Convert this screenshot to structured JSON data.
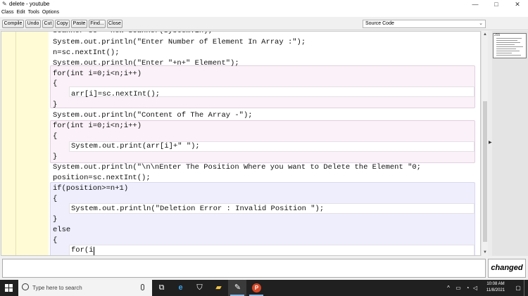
{
  "window": {
    "title": "delete - youtube",
    "app_icon": "bluej-bird-icon",
    "controls": {
      "minimize": "—",
      "maximize": "□",
      "close": "✕"
    }
  },
  "menubar": {
    "items": [
      "Class",
      "Edit",
      "Tools",
      "Options"
    ]
  },
  "toolbar": {
    "buttons": [
      "Compile",
      "Undo",
      "Cut",
      "Copy",
      "Paste",
      "Find...",
      "Close"
    ],
    "view_select": "Source Code"
  },
  "editor": {
    "lines": [
      "Scanner sc = new Scanner(System.in);",
      "System.out.println(\"Enter Number of Element In Array :\");",
      "n=sc.nextInt();",
      "System.out.println(\"Enter \"+n+\" Element\");",
      "for(int i=0;i<n;i++)",
      "{",
      "arr[i]=sc.nextInt();",
      "}",
      "System.out.println(\"Content of The Array -\");",
      "for(int i=0;i<n;i++)",
      "{",
      "System.out.print(arr[i]+\" \");",
      "}",
      "System.out.println(\"\\n\\nEnter The Position Where you want to Delete the Element \"0;",
      "position=sc.nextInt();",
      "if(position>=n+1)",
      "{",
      "System.out.println(\"Deletion Error : Invalid Position \");",
      "}",
      "else",
      "{",
      "for(i"
    ],
    "overview_label": "255"
  },
  "status": {
    "message": "",
    "changed_label": "changed"
  },
  "taskbar": {
    "search_placeholder": "Type here to search",
    "time": "10:08 AM",
    "date": "11/8/2021",
    "icons": [
      "task-view-icon",
      "edge-icon",
      "store-icon",
      "file-explorer-icon",
      "bluej-icon",
      "powerpoint-icon"
    ]
  },
  "colors": {
    "gutter": "#fffbd5",
    "scope_method": "#fbf1f8",
    "scope_conditional": "#eeeefc",
    "taskbar": "#202020"
  }
}
